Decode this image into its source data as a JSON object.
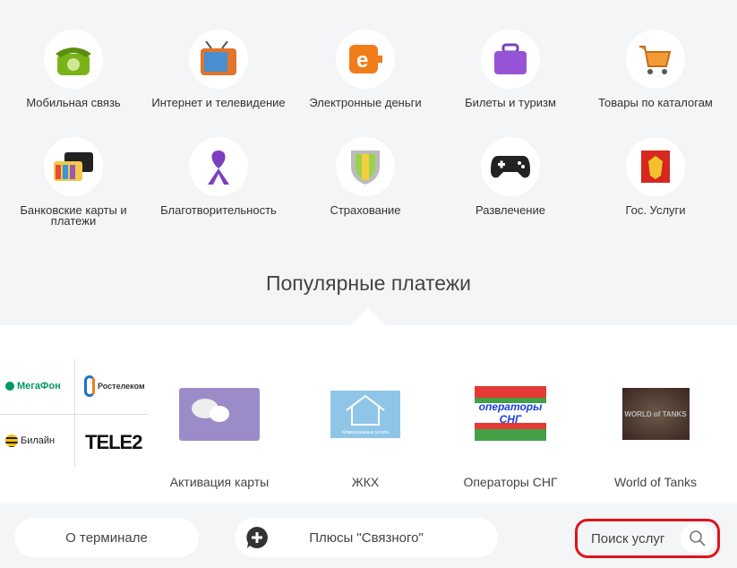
{
  "categories": [
    {
      "label": "Мобильная связь",
      "icon": "phone-icon"
    },
    {
      "label": "Интернет и телевидение",
      "icon": "tv-icon"
    },
    {
      "label": "Электронные деньги",
      "icon": "e-money-icon"
    },
    {
      "label": "Билеты и туризм",
      "icon": "suitcase-icon"
    },
    {
      "label": "Товары по каталогам",
      "icon": "cart-icon"
    },
    {
      "label": "Банковские карты и платежи",
      "icon": "cards-icon"
    },
    {
      "label": "Благотворительность",
      "icon": "ribbon-icon"
    },
    {
      "label": "Страхование",
      "icon": "shield-icon"
    },
    {
      "label": "Развлечение",
      "icon": "gamepad-icon"
    },
    {
      "label": "Гос. Услуги",
      "icon": "coat-of-arms-icon"
    }
  ],
  "popular_title": "Популярные платежи",
  "operators": [
    "МегаФон",
    "Ростелеком",
    "Билайн",
    "TELE2"
  ],
  "popular": [
    {
      "label": "Активация карты"
    },
    {
      "label": "ЖКХ",
      "image_text": "Коммунальные услуги"
    },
    {
      "label": "Операторы СНГ",
      "image_text": "операторы СНГ"
    },
    {
      "label": "World of Tanks",
      "image_text": "WORLD of TANKS"
    }
  ],
  "footer": {
    "terminal": "О терминале",
    "plus": "Плюсы \"Связного\"",
    "search": "Поиск услуг"
  },
  "colors": {
    "highlight": "#e0141e",
    "megafon": "#00985f",
    "beeline": "#f5c000"
  }
}
